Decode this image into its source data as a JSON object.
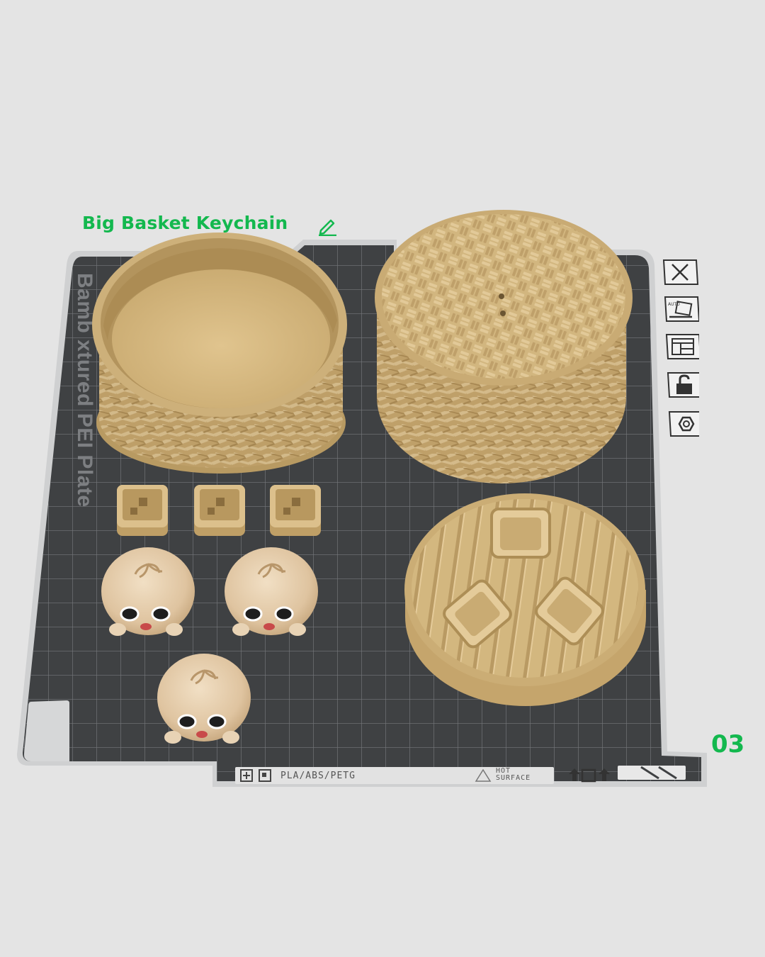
{
  "plate": {
    "title": "Big Basket Keychain",
    "number": "03",
    "bed_label": "Bambu Textured PEI Plate",
    "bed_label_visible": "Bamb  xtured PEI Plate",
    "strip": {
      "materials": "PLA/ABS/PETG",
      "warning_line1": "HOT",
      "warning_line2": "SURFACE"
    }
  },
  "toolbar": {
    "items": [
      {
        "name": "close",
        "icon": "close-icon"
      },
      {
        "name": "auto-orient",
        "icon": "auto-orient-icon",
        "label": "AUTO"
      },
      {
        "name": "arrange",
        "icon": "arrange-icon"
      },
      {
        "name": "lock",
        "icon": "lock-icon"
      },
      {
        "name": "settings",
        "icon": "hex-nut-icon"
      }
    ]
  },
  "colors": {
    "accent": "#13b84e",
    "bed": "#3f4143",
    "grid": "#7a7c7e",
    "model": "#d7bc86",
    "background": "#e4e4e4"
  },
  "models": {
    "basket_bottom": "open basket",
    "basket_lid": "woven lid",
    "steamer_base": "base with slots",
    "square_holders": 3,
    "bun_keychains": 3
  }
}
